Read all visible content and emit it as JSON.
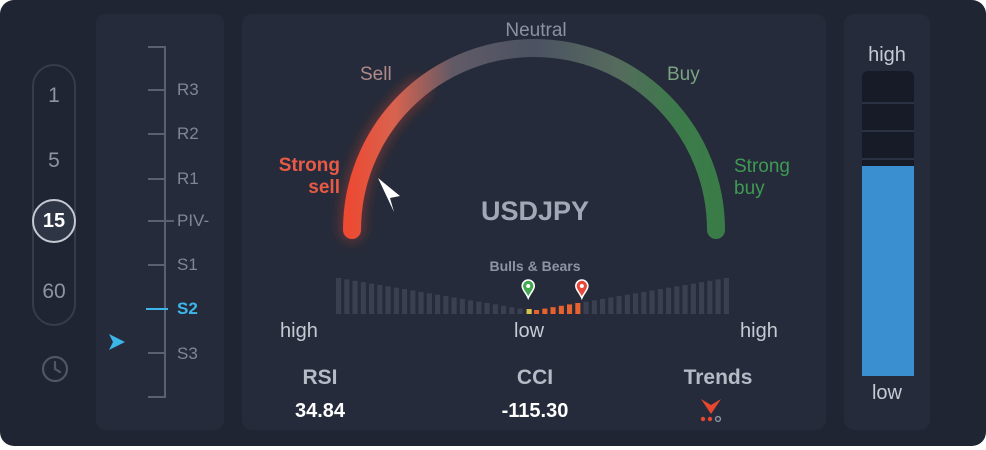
{
  "timeframes": {
    "options": [
      "1",
      "5",
      "15",
      "60"
    ],
    "selected": "15"
  },
  "pivots": {
    "levels": [
      "R3",
      "R2",
      "R1",
      "PIV-",
      "S1",
      "S2",
      "S3"
    ],
    "active": "S2"
  },
  "gauge": {
    "labels": {
      "neutral": "Neutral",
      "sell": "Sell",
      "buy": "Buy",
      "strong_sell_1": "Strong",
      "strong_sell_2": "sell",
      "strong_buy_1": "Strong",
      "strong_buy_2": "buy"
    },
    "symbol": "USDJPY",
    "signal": "Strong sell"
  },
  "bulls_bears": {
    "title": "Bulls & Bears",
    "left_label": "high",
    "center_label": "low",
    "right_label": "high",
    "bar_count": 48,
    "active_from_center_right": 6
  },
  "metrics": {
    "rsi": {
      "label": "RSI",
      "value": "34.84"
    },
    "cci": {
      "label": "CCI",
      "value": "-115.30"
    },
    "trends": {
      "label": "Trends",
      "direction": "down"
    }
  },
  "volume": {
    "top_label": "high",
    "bottom_label": "low",
    "level": 0.69
  },
  "colors": {
    "sell": "#e85a45",
    "buy": "#3f8a4d",
    "accent": "#3cb6ea",
    "trend": "#e8472f",
    "volume": "#3a8fd0"
  },
  "icons": {
    "clock": "clock-icon",
    "pointer": "pointer-arrow-icon",
    "needle": "needle-icon",
    "trend": "trend-down-icon"
  }
}
